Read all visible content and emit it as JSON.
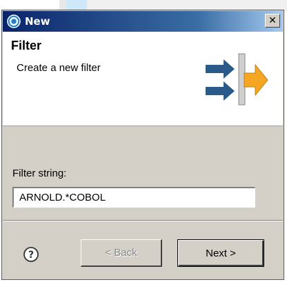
{
  "window": {
    "title": "New",
    "close_glyph": "✕"
  },
  "header": {
    "title": "Filter",
    "description": "Create a new filter",
    "icon": "wizard-arrows-icon"
  },
  "form": {
    "filter_label": "Filter string:",
    "filter_value": "ARNOLD.*COBOL"
  },
  "footer": {
    "help_icon": "help-icon",
    "back_label": "< Back",
    "next_label": "Next >"
  },
  "colors": {
    "titlebar_start": "#0a246a",
    "titlebar_end": "#a6caf0",
    "dialog_bg": "#d4d0c8",
    "header_bg": "#ffffff",
    "accent_orange": "#f5a623",
    "arrow_blue": "#2a5a8a"
  }
}
